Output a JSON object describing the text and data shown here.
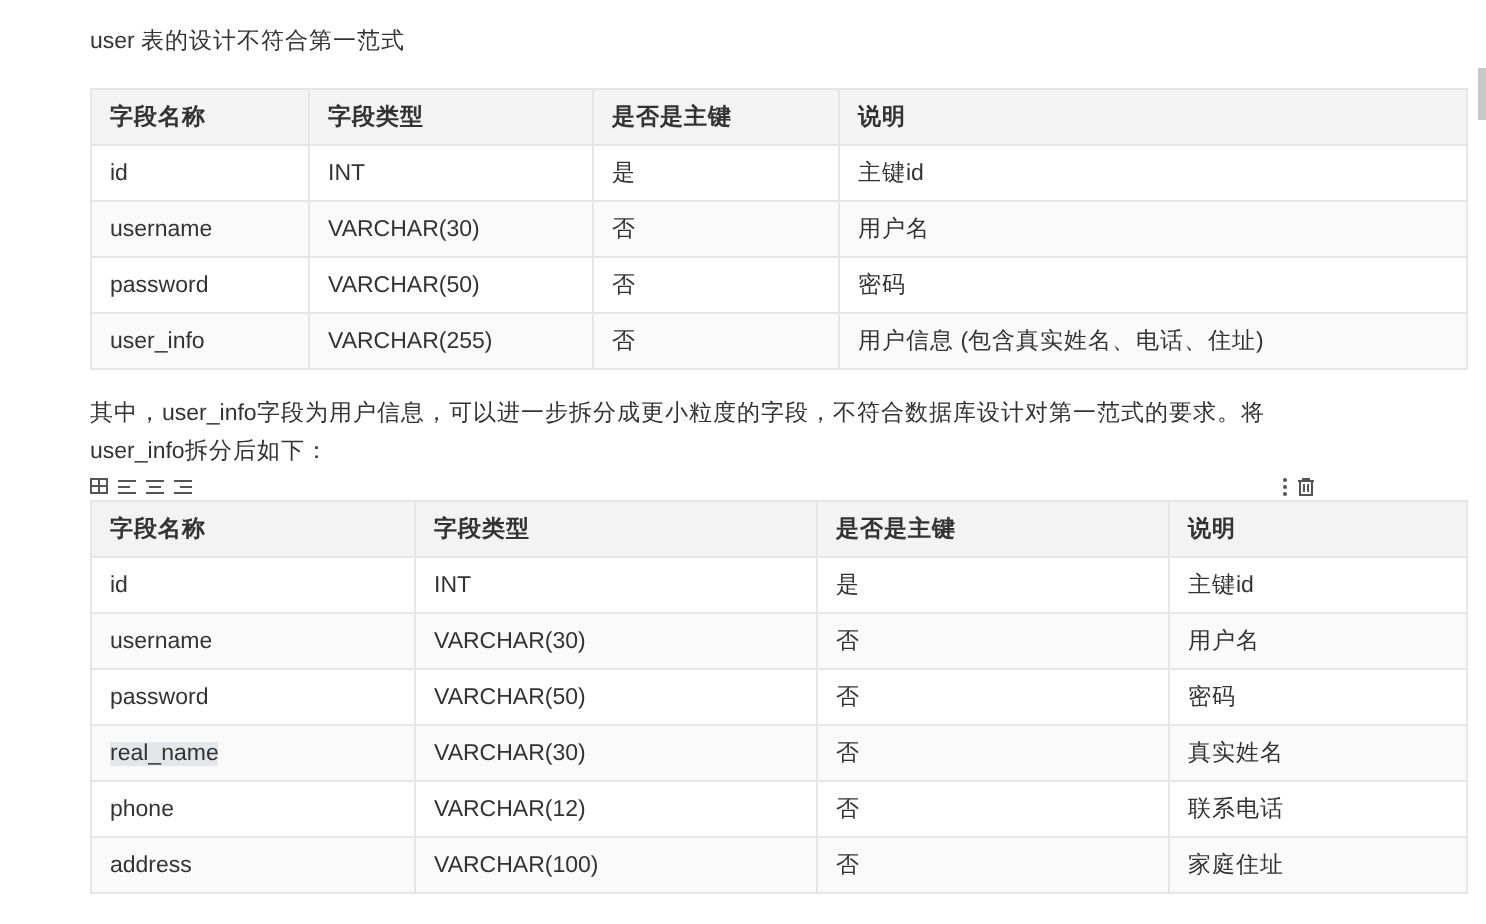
{
  "intro": "user 表的设计不符合第一范式",
  "table_1": {
    "columns": [
      "字段名称",
      "字段类型",
      "是否是主键",
      "说明"
    ],
    "rows": [
      {
        "cells": [
          "id",
          "INT",
          "是",
          "主键id"
        ],
        "highlighted": false
      },
      {
        "cells": [
          "username",
          "VARCHAR(30)",
          "否",
          "用户名"
        ],
        "highlighted": false
      },
      {
        "cells": [
          "password",
          "VARCHAR(50)",
          "否",
          "密码"
        ],
        "highlighted": false
      },
      {
        "cells": [
          "user_info",
          "VARCHAR(255)",
          "否",
          "用户信息 (包含真实姓名、电话、住址)"
        ],
        "highlighted": false
      }
    ]
  },
  "paragraph": "其中，user_info字段为用户信息，可以进一步拆分成更小粒度的字段，不符合数据库设计对第一范式的要求。将user_info拆分后如下：",
  "table_2": {
    "columns": [
      "字段名称",
      "字段类型",
      "是否是主键",
      "说明"
    ],
    "rows": [
      {
        "cells": [
          "id",
          "INT",
          "是",
          "主键id"
        ],
        "highlighted": false
      },
      {
        "cells": [
          "username",
          "VARCHAR(30)",
          "否",
          "用户名"
        ],
        "highlighted": false
      },
      {
        "cells": [
          "password",
          "VARCHAR(50)",
          "否",
          "密码"
        ],
        "highlighted": false
      },
      {
        "cells": [
          "real_name",
          "VARCHAR(30)",
          "否",
          "真实姓名"
        ],
        "highlighted": true
      },
      {
        "cells": [
          "phone",
          "VARCHAR(12)",
          "否",
          "联系电话"
        ],
        "highlighted": false
      },
      {
        "cells": [
          "address",
          "VARCHAR(100)",
          "否",
          "家庭住址"
        ],
        "highlighted": false
      }
    ]
  }
}
